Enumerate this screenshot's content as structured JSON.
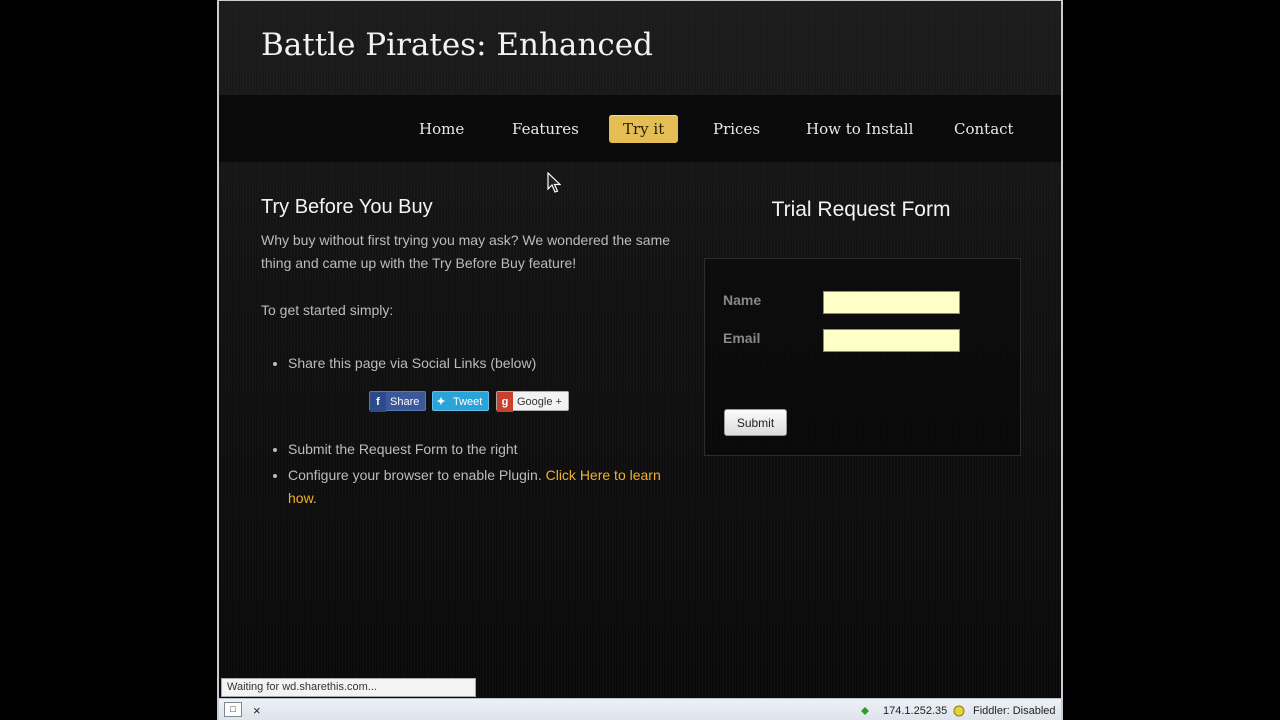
{
  "site": {
    "title": "Battle Pirates: Enhanced"
  },
  "nav": {
    "items": [
      {
        "label": "Home",
        "active": false
      },
      {
        "label": "Features",
        "active": false
      },
      {
        "label": "Try it",
        "active": true
      },
      {
        "label": "Prices",
        "active": false
      },
      {
        "label": "How to Install",
        "active": false
      },
      {
        "label": "Contact",
        "active": false
      }
    ]
  },
  "content": {
    "heading": "Try Before You Buy",
    "intro": "Why buy without first trying you may ask? We wondered the same thing and came up with the Try Before Buy feature!",
    "get_started": "To get started simply:",
    "step1": "Share this page via Social Links (below)",
    "step2": "Submit the Request Form to the right",
    "step3_text": "Configure your browser to enable Plugin.",
    "step3_link": "Click Here to learn how",
    "step3_end": "."
  },
  "social": {
    "share": "Share",
    "tweet": "Tweet",
    "google": "Google +"
  },
  "form": {
    "title": "Trial Request Form",
    "name_label": "Name",
    "email_label": "Email",
    "name_value": "",
    "email_value": "",
    "submit_label": "Submit"
  },
  "status": {
    "loading_text": "Waiting for wd.sharethis.com...",
    "ip": "174.1.252.35",
    "fiddler": "Fiddler: Disabled",
    "close_glyph": "×"
  },
  "colors": {
    "accent": "#e5bd55",
    "link": "#f0b030",
    "input_bg": "#ffffc8"
  }
}
